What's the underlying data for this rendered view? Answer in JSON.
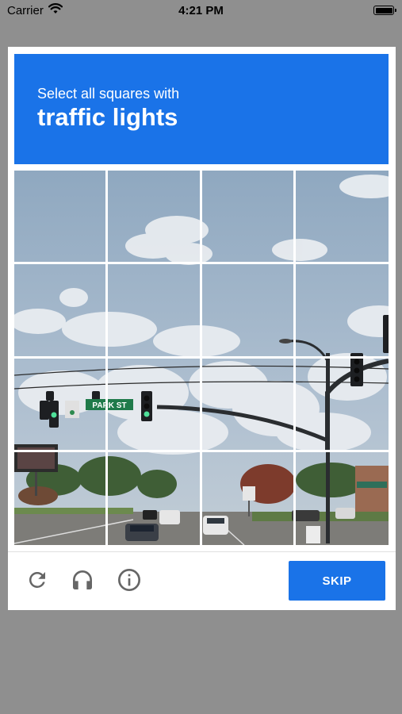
{
  "status_bar": {
    "carrier": "Carrier",
    "time": "4:21 PM",
    "icons": [
      "wifi-icon",
      "battery-icon"
    ]
  },
  "captcha": {
    "instruction": "Select all squares with",
    "target": "traffic lights",
    "street_sign": "PARK ST",
    "grid": {
      "rows": 4,
      "cols": 4
    },
    "tiles": [
      {
        "row": 1,
        "col": 1
      },
      {
        "row": 1,
        "col": 2
      },
      {
        "row": 1,
        "col": 3
      },
      {
        "row": 1,
        "col": 4
      },
      {
        "row": 2,
        "col": 1
      },
      {
        "row": 2,
        "col": 2
      },
      {
        "row": 2,
        "col": 3
      },
      {
        "row": 2,
        "col": 4
      },
      {
        "row": 3,
        "col": 1
      },
      {
        "row": 3,
        "col": 2
      },
      {
        "row": 3,
        "col": 3
      },
      {
        "row": 3,
        "col": 4
      },
      {
        "row": 4,
        "col": 1
      },
      {
        "row": 4,
        "col": 2
      },
      {
        "row": 4,
        "col": 3
      },
      {
        "row": 4,
        "col": 4
      }
    ],
    "footer": {
      "icons": [
        "reload-icon",
        "headphones-icon",
        "info-icon"
      ],
      "skip_label": "SKIP"
    },
    "colors": {
      "accent": "#1a73e8",
      "sky": "#9fb5cb",
      "overlay": "#8f8f8f"
    }
  }
}
